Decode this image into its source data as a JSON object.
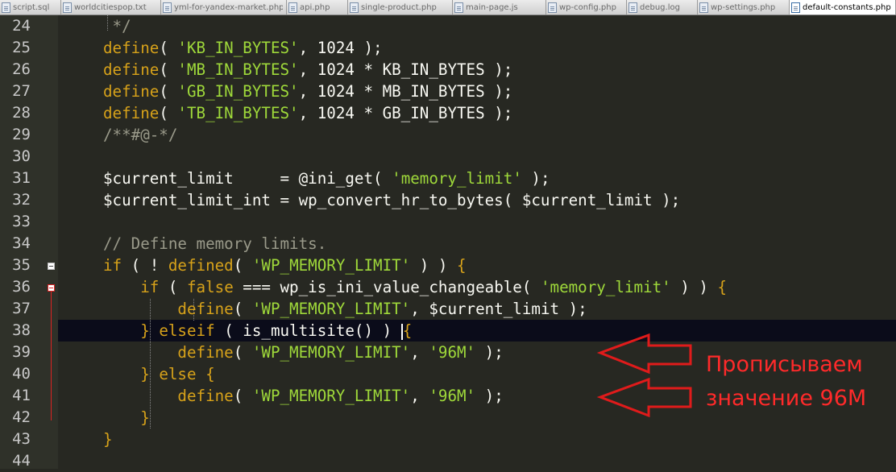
{
  "tabs": [
    {
      "label": "script.sql",
      "active": false
    },
    {
      "label": "worldcitiespop.txt",
      "active": false
    },
    {
      "label": "yml-for-yandex-market.php",
      "active": false
    },
    {
      "label": "api.php",
      "active": false
    },
    {
      "label": "single-product.php",
      "active": false
    },
    {
      "label": "main-page.js",
      "active": false
    },
    {
      "label": "wp-config.php",
      "active": false
    },
    {
      "label": "debug.log",
      "active": false
    },
    {
      "label": "wp-settings.php",
      "active": false
    },
    {
      "label": "default-constants.php",
      "active": true
    }
  ],
  "line_numbers": [
    "24",
    "25",
    "26",
    "27",
    "28",
    "29",
    "30",
    "31",
    "32",
    "33",
    "34",
    "35",
    "36",
    "37",
    "38",
    "39",
    "40",
    "41",
    "42",
    "43",
    "44"
  ],
  "code_lines": [
    {
      "n": "24",
      "tokens": [
        {
          "t": " */",
          "c": "cmt"
        }
      ]
    },
    {
      "n": "25",
      "tokens": [
        {
          "t": "define",
          "c": "kw"
        },
        {
          "t": "( ",
          "c": "op"
        },
        {
          "t": "'KB_IN_BYTES'",
          "c": "str"
        },
        {
          "t": ", 1024 );",
          "c": "op"
        }
      ]
    },
    {
      "n": "26",
      "tokens": [
        {
          "t": "define",
          "c": "kw"
        },
        {
          "t": "( ",
          "c": "op"
        },
        {
          "t": "'MB_IN_BYTES'",
          "c": "str"
        },
        {
          "t": ", 1024 * KB_IN_BYTES );",
          "c": "op"
        }
      ]
    },
    {
      "n": "27",
      "tokens": [
        {
          "t": "define",
          "c": "kw"
        },
        {
          "t": "( ",
          "c": "op"
        },
        {
          "t": "'GB_IN_BYTES'",
          "c": "str"
        },
        {
          "t": ", 1024 * MB_IN_BYTES );",
          "c": "op"
        }
      ]
    },
    {
      "n": "28",
      "tokens": [
        {
          "t": "define",
          "c": "kw"
        },
        {
          "t": "( ",
          "c": "op"
        },
        {
          "t": "'TB_IN_BYTES'",
          "c": "str"
        },
        {
          "t": ", 1024 * GB_IN_BYTES );",
          "c": "op"
        }
      ]
    },
    {
      "n": "29",
      "tokens": [
        {
          "t": "/**#@-*/",
          "c": "cmt"
        }
      ]
    },
    {
      "n": "30",
      "tokens": []
    },
    {
      "n": "31",
      "tokens": [
        {
          "t": "$current_limit     = @",
          "c": "var"
        },
        {
          "t": "ini_get",
          "c": "fn"
        },
        {
          "t": "( ",
          "c": "op"
        },
        {
          "t": "'memory_limit'",
          "c": "str"
        },
        {
          "t": " );",
          "c": "op"
        }
      ]
    },
    {
      "n": "32",
      "tokens": [
        {
          "t": "$current_limit_int = wp_convert_hr_to_bytes( $current_limit );",
          "c": "var"
        }
      ]
    },
    {
      "n": "33",
      "tokens": []
    },
    {
      "n": "34",
      "tokens": [
        {
          "t": "// Define memory limits.",
          "c": "cmt"
        }
      ]
    },
    {
      "n": "35",
      "tokens": [
        {
          "t": "if",
          "c": "kw"
        },
        {
          "t": " ( ! ",
          "c": "op"
        },
        {
          "t": "defined",
          "c": "kw"
        },
        {
          "t": "( ",
          "c": "op"
        },
        {
          "t": "'WP_MEMORY_LIMIT'",
          "c": "str"
        },
        {
          "t": " ) ) ",
          "c": "op"
        },
        {
          "t": "{",
          "c": "brace"
        }
      ]
    },
    {
      "n": "36",
      "tokens": [
        {
          "t": "    ",
          "c": "op"
        },
        {
          "t": "if",
          "c": "kw"
        },
        {
          "t": " ( ",
          "c": "op"
        },
        {
          "t": "false",
          "c": "kw"
        },
        {
          "t": " === wp_is_ini_value_changeable( ",
          "c": "op"
        },
        {
          "t": "'memory_limit'",
          "c": "str"
        },
        {
          "t": " ) ) ",
          "c": "op"
        },
        {
          "t": "{",
          "c": "brace"
        }
      ]
    },
    {
      "n": "37",
      "tokens": [
        {
          "t": "        ",
          "c": "op"
        },
        {
          "t": "define",
          "c": "kw"
        },
        {
          "t": "( ",
          "c": "op"
        },
        {
          "t": "'WP_MEMORY_LIMIT'",
          "c": "str"
        },
        {
          "t": ", $current_limit );",
          "c": "op"
        }
      ]
    },
    {
      "n": "38",
      "tokens": [
        {
          "t": "    ",
          "c": "op"
        },
        {
          "t": "} ",
          "c": "brace"
        },
        {
          "t": "elseif",
          "c": "kw"
        },
        {
          "t": " ( is_multisite() ) ",
          "c": "op"
        },
        {
          "t": "{",
          "c": "brace"
        }
      ]
    },
    {
      "n": "39",
      "tokens": [
        {
          "t": "        ",
          "c": "op"
        },
        {
          "t": "define",
          "c": "kw"
        },
        {
          "t": "( ",
          "c": "op"
        },
        {
          "t": "'WP_MEMORY_LIMIT'",
          "c": "str"
        },
        {
          "t": ", ",
          "c": "op"
        },
        {
          "t": "'96M'",
          "c": "str"
        },
        {
          "t": " );",
          "c": "op"
        }
      ]
    },
    {
      "n": "40",
      "tokens": [
        {
          "t": "    ",
          "c": "op"
        },
        {
          "t": "} ",
          "c": "brace"
        },
        {
          "t": "else",
          "c": "kw"
        },
        {
          "t": " ",
          "c": "op"
        },
        {
          "t": "{",
          "c": "brace"
        }
      ]
    },
    {
      "n": "41",
      "tokens": [
        {
          "t": "        ",
          "c": "op"
        },
        {
          "t": "define",
          "c": "kw"
        },
        {
          "t": "( ",
          "c": "op"
        },
        {
          "t": "'WP_MEMORY_LIMIT'",
          "c": "str"
        },
        {
          "t": ", ",
          "c": "op"
        },
        {
          "t": "'96M'",
          "c": "str"
        },
        {
          "t": " );",
          "c": "op"
        }
      ]
    },
    {
      "n": "42",
      "tokens": [
        {
          "t": "    ",
          "c": "op"
        },
        {
          "t": "}",
          "c": "brace"
        }
      ]
    },
    {
      "n": "43",
      "tokens": [
        {
          "t": "}",
          "c": "brace"
        }
      ]
    },
    {
      "n": "44",
      "tokens": []
    }
  ],
  "annotation": {
    "line1": "Прописываем",
    "line2": "значение 96M",
    "color": "#ff2a2a"
  },
  "colors": {
    "background": "#272822",
    "keyword": "#d7a21a",
    "string": "#9fd93a",
    "plain": "#f8f8f2",
    "comment": "#9a9a8a",
    "current_line": "#0b0c1a",
    "line_number": "#c8c8c8"
  }
}
